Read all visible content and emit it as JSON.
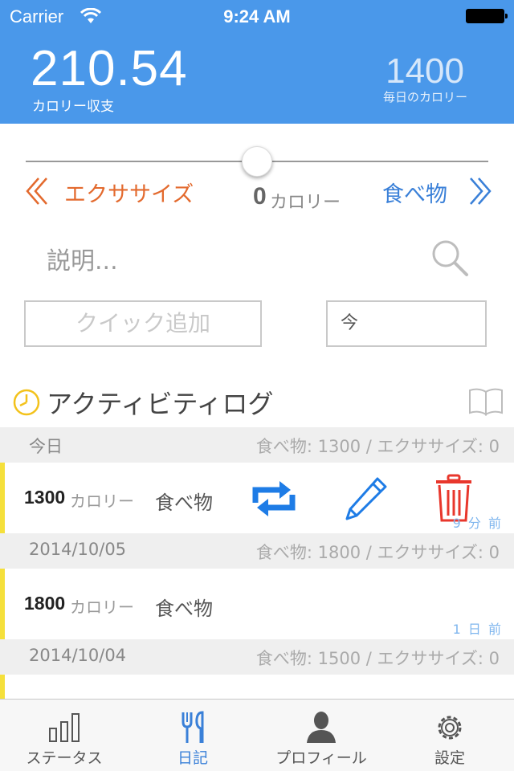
{
  "status_bar": {
    "carrier": "Carrier",
    "time": "9:24 AM"
  },
  "header": {
    "balance_value": "210.54",
    "balance_label": "カロリー収支",
    "daily_value": "1400",
    "daily_label": "毎日のカロリー"
  },
  "entry_form": {
    "slider_value": 0.5,
    "exercise_label": "エクササイズ",
    "food_label": "食べ物",
    "calorie_amount": "0",
    "calorie_unit": "カロリー",
    "description_placeholder": "説明...",
    "quick_add_label": "クイック追加",
    "time_value": "今"
  },
  "activity_log": {
    "title": "アクティビティログ",
    "sections": [
      {
        "date": "今日",
        "summary": "食べ物: 1300 / エクササイズ: 0",
        "entry": {
          "calories": "1300",
          "unit": "カロリー",
          "type": "食べ物",
          "time_ago": "9 分 前"
        }
      },
      {
        "date": "2014/10/05",
        "summary": "食べ物: 1800 / エクササイズ: 0",
        "entry": {
          "calories": "1800",
          "unit": "カロリー",
          "type": "食べ物",
          "time_ago": "1 日 前"
        }
      },
      {
        "date": "2014/10/04",
        "summary": "食べ物: 1500 / エクササイズ: 0"
      }
    ]
  },
  "tab_bar": {
    "tabs": [
      {
        "label": "ステータス",
        "icon": "bar-chart-icon"
      },
      {
        "label": "日記",
        "icon": "fork-knife-icon",
        "active": true
      },
      {
        "label": "プロフィール",
        "icon": "person-icon"
      },
      {
        "label": "設定",
        "icon": "gear-icon"
      }
    ]
  },
  "colors": {
    "header_bg": "#4a98ea",
    "exercise": "#e36a2e",
    "food": "#3a80d8",
    "delete": "#e8372c",
    "entry_marker": "#f5e03b"
  }
}
